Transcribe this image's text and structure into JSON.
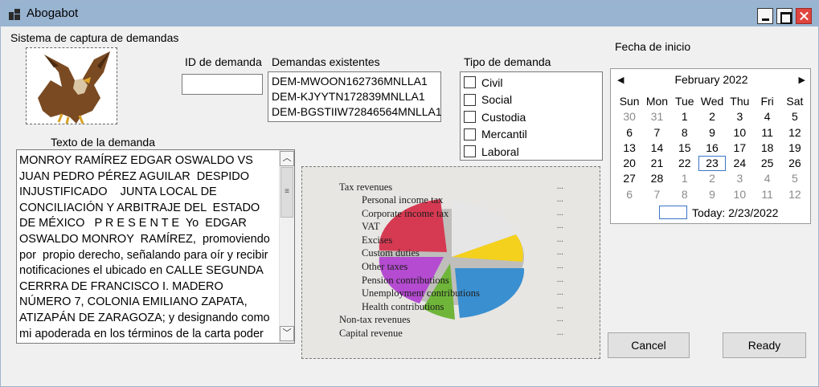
{
  "window": {
    "title": "Abogabot",
    "icon": "app-grid-icon"
  },
  "form": {
    "header": "Sistema de captura de demandas",
    "id_label": "ID de demanda",
    "id_value": "",
    "existing_label": "Demandas existentes",
    "existing_items": [
      "DEM-MWOON162736MNLLA1",
      "DEM-KJYYTN172839MNLLA1",
      "DEM-BGSTIIW72846564MNLLA1"
    ],
    "type_label": "Tipo de demanda",
    "types": [
      {
        "label": "Civil",
        "checked": false
      },
      {
        "label": "Social",
        "checked": false
      },
      {
        "label": "Custodia",
        "checked": false
      },
      {
        "label": "Mercantil",
        "checked": false
      },
      {
        "label": "Laboral",
        "checked": false
      }
    ],
    "text_label": "Texto de la demanda",
    "text_value": "MONROY RAMÍREZ EDGAR OSWALDO VS JUAN PEDRO PÉREZ AGUILAR  DESPIDO INJUSTIFICADO    JUNTA LOCAL DE CONCILIACIÓN Y ARBITRAJE DEL  ESTADO DE MÉXICO   P R E S E N T E  Yo  EDGAR  OSWALDO MONROY  RAMÍREZ,  promoviendo  por  propio derecho, señalando para oír y recibir notificaciones el ubicado en CALLE SEGUNDA CERRRA DE FRANCISCO I. MADERO NÚMERO 7, COLONIA EMILIANO ZAPATA, ATIZAPÁN DE ZARAGOZA; y designando como mi apoderada en los términos de la carta poder que se adjunta",
    "date_label": "Fecha de inicio"
  },
  "picture": {
    "lines": [
      "Tax revenues",
      "Personal income tax",
      "Corporate income tax",
      "VAT",
      "Excises",
      "Custom duties",
      "Other taxes",
      "Pension contributions",
      "Unemployment contributions",
      "Health contributions",
      "Non-tax revenues",
      "Capital revenue"
    ],
    "dots": "...",
    "slice_colors": [
      "#e6e6e6",
      "#d63a52",
      "#f4d11c",
      "#3a8fd0",
      "#6fb539",
      "#b44bd0"
    ]
  },
  "calendar": {
    "month_label": "February 2022",
    "prev_icon": "triangle-left-icon",
    "next_icon": "triangle-right-icon",
    "weekdays": [
      "Sun",
      "Mon",
      "Tue",
      "Wed",
      "Thu",
      "Fri",
      "Sat"
    ],
    "days": [
      {
        "d": "30",
        "dim": true
      },
      {
        "d": "31",
        "dim": true
      },
      {
        "d": "1"
      },
      {
        "d": "2"
      },
      {
        "d": "3"
      },
      {
        "d": "4"
      },
      {
        "d": "5"
      },
      {
        "d": "6"
      },
      {
        "d": "7"
      },
      {
        "d": "8"
      },
      {
        "d": "9"
      },
      {
        "d": "10"
      },
      {
        "d": "11"
      },
      {
        "d": "12"
      },
      {
        "d": "13"
      },
      {
        "d": "14"
      },
      {
        "d": "15"
      },
      {
        "d": "16"
      },
      {
        "d": "17"
      },
      {
        "d": "18"
      },
      {
        "d": "19"
      },
      {
        "d": "20"
      },
      {
        "d": "21"
      },
      {
        "d": "22"
      },
      {
        "d": "23",
        "selected": true
      },
      {
        "d": "24"
      },
      {
        "d": "25"
      },
      {
        "d": "26"
      },
      {
        "d": "27"
      },
      {
        "d": "28"
      },
      {
        "d": "1",
        "dim": true
      },
      {
        "d": "2",
        "dim": true
      },
      {
        "d": "3",
        "dim": true
      },
      {
        "d": "4",
        "dim": true
      },
      {
        "d": "5",
        "dim": true
      },
      {
        "d": "6",
        "dim": true
      },
      {
        "d": "7",
        "dim": true
      },
      {
        "d": "8",
        "dim": true
      },
      {
        "d": "9",
        "dim": true
      },
      {
        "d": "10",
        "dim": true
      },
      {
        "d": "11",
        "dim": true
      },
      {
        "d": "12",
        "dim": true
      }
    ],
    "today_label": "Today: 2/23/2022"
  },
  "buttons": {
    "cancel": "Cancel",
    "ready": "Ready"
  },
  "scrollbar": {
    "up_icon": "scroll-up-icon",
    "down_icon": "scroll-down-icon",
    "grip_icon": "grip-icon"
  }
}
